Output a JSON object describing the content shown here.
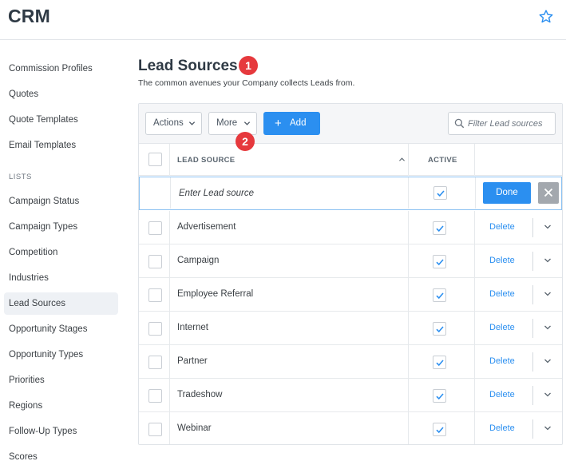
{
  "app": {
    "title": "CRM"
  },
  "sidebar": {
    "items": [
      {
        "label": "Commission Profiles"
      },
      {
        "label": "Quotes"
      },
      {
        "label": "Quote Templates"
      },
      {
        "label": "Email Templates"
      }
    ],
    "section_label": "LISTS",
    "list_items": [
      {
        "label": "Campaign Status"
      },
      {
        "label": "Campaign Types"
      },
      {
        "label": "Competition"
      },
      {
        "label": "Industries"
      },
      {
        "label": "Lead Sources",
        "active": true
      },
      {
        "label": "Opportunity Stages"
      },
      {
        "label": "Opportunity Types"
      },
      {
        "label": "Priorities"
      },
      {
        "label": "Regions"
      },
      {
        "label": "Follow-Up Types"
      },
      {
        "label": "Scores"
      }
    ]
  },
  "page": {
    "title": "Lead Sources",
    "description": "The common avenues your Company collects Leads from."
  },
  "badges": {
    "first": "1",
    "second": "2"
  },
  "toolbar": {
    "actions_label": "Actions",
    "more_label": "More",
    "add_label": "Add",
    "filter_placeholder": "Filter Lead sources"
  },
  "table": {
    "headers": {
      "lead_source": "LEAD SOURCE",
      "active": "ACTIVE"
    },
    "edit_row": {
      "placeholder": "Enter Lead source",
      "done_label": "Done"
    },
    "delete_label": "Delete",
    "rows": [
      {
        "name": "Advertisement",
        "active": true
      },
      {
        "name": "Campaign",
        "active": true
      },
      {
        "name": "Employee Referral",
        "active": true
      },
      {
        "name": "Internet",
        "active": true
      },
      {
        "name": "Partner",
        "active": true
      },
      {
        "name": "Tradeshow",
        "active": true
      },
      {
        "name": "Webinar",
        "active": true
      }
    ]
  },
  "colors": {
    "accent": "#2b8ff0",
    "badge": "#e6393d",
    "done_button": "#2b8ff0",
    "cancel_button": "#a3a8ae"
  },
  "icons": [
    "star-icon",
    "chevron-down-icon",
    "plus-icon",
    "search-icon",
    "sort-up-icon",
    "check-icon",
    "close-icon"
  ]
}
